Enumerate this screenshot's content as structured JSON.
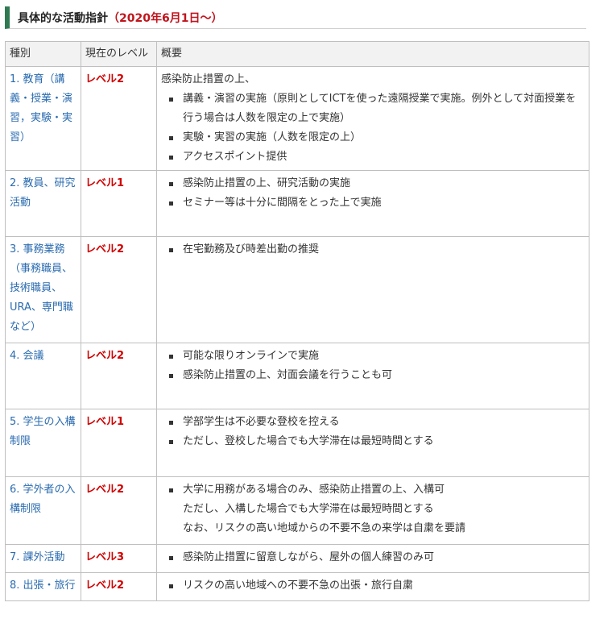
{
  "heading": {
    "title": "具体的な活動指針",
    "date": "（2020年6月1日～）"
  },
  "headers": [
    "種別",
    "現在のレベル",
    "概要"
  ],
  "rows": [
    {
      "category": "1. 教育（講義・授業・演習，実験・実習）",
      "level": "レベル2",
      "intro": "感染防止措置の上、",
      "items": [
        "講義・演習の実施（原則としてICTを使った遠隔授業で実施。例外として対面授業を行う場合は人数を限定の上で実施）",
        "実験・実習の実施（人数を限定の上）",
        "アクセスポイント提供"
      ]
    },
    {
      "category": "2. 教員、研究活動",
      "level": "レベル1",
      "items": [
        "感染防止措置の上、研究活動の実施",
        "セミナー等は十分に間隔をとった上で実施"
      ]
    },
    {
      "category": "3. 事務業務（事務職員、技術職員、URA、専門職など）",
      "level": "レベル2",
      "items": [
        "在宅勤務及び時差出勤の推奨"
      ]
    },
    {
      "category": "4. 会議",
      "level": "レベル2",
      "items": [
        "可能な限りオンラインで実施",
        "感染防止措置の上、対面会議を行うことも可"
      ]
    },
    {
      "category": "5. 学生の入構制限",
      "level": "レベル1",
      "items": [
        "学部学生は不必要な登校を控える",
        "ただし、登校した場合でも大学滞在は最短時間とする"
      ]
    },
    {
      "category": "6. 学外者の入構制限",
      "level": "レベル2",
      "items": [
        "大学に用務がある場合のみ、感染防止措置の上、入構可"
      ],
      "extra": [
        "ただし、入構した場合でも大学滞在は最短時間とする",
        "なお、リスクの高い地域からの不要不急の来学は自粛を要請"
      ]
    },
    {
      "category": "7. 課外活動",
      "level": "レベル3",
      "items": [
        " 感染防止措置に留意しながら、屋外の個人練習のみ可"
      ]
    },
    {
      "category": "8. 出張・旅行",
      "level": "レベル2",
      "items": [
        "リスクの高い地域への不要不急の出張・旅行自粛"
      ]
    }
  ]
}
